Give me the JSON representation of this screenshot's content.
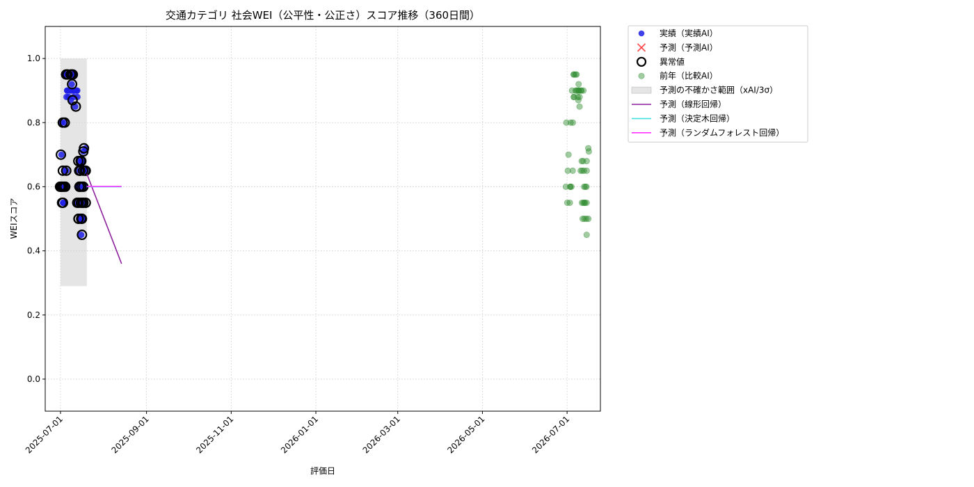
{
  "chart_data": {
    "type": "scatter",
    "title": "交通カテゴリ 社会WEI（公平性・公正さ）スコア推移（360日間）",
    "xlabel": "評価日",
    "ylabel": "WEIスコア",
    "xlim": [
      "2025-06-20",
      "2026-07-25"
    ],
    "ylim": [
      -0.1,
      1.1
    ],
    "x_ticks": [
      "2025-07-01",
      "2025-09-01",
      "2025-11-01",
      "2026-01-01",
      "2026-03-01",
      "2026-05-01",
      "2026-07-01"
    ],
    "y_ticks": [
      0.0,
      0.2,
      0.4,
      0.6,
      0.8,
      1.0
    ],
    "y_tick_labels": [
      "0.0",
      "0.2",
      "0.4",
      "0.6",
      "0.8",
      "1.0"
    ],
    "grid": true,
    "legend_position": "outside-right",
    "colors": {
      "actual": "#1f1fe6",
      "forecast": "#ff3333",
      "anomaly": "#000000",
      "prior_year": "#2e8b2e",
      "uncertainty": "#d3d3d3",
      "linear": "#8b1e9a",
      "tree": "#40e0e0",
      "forest": "#ff33ff"
    },
    "legend": [
      {
        "key": "actual",
        "label": "実績（実績AI）",
        "marker": "dot"
      },
      {
        "key": "forecast",
        "label": "予測（予測AI）",
        "marker": "cross"
      },
      {
        "key": "anomaly",
        "label": "異常値",
        "marker": "ring"
      },
      {
        "key": "prior_year",
        "label": "前年（比較AI）",
        "marker": "dot-faded"
      },
      {
        "key": "uncertainty",
        "label": "予測の不確かさ範囲（xAI/3σ）",
        "marker": "band"
      },
      {
        "key": "linear",
        "label": "予測（線形回帰）",
        "marker": "line"
      },
      {
        "key": "tree",
        "label": "予測（決定木回帰）",
        "marker": "line"
      },
      {
        "key": "forest",
        "label": "予測（ランダムフォレスト回帰）",
        "marker": "line"
      }
    ],
    "series": [
      {
        "key": "actual",
        "points": [
          {
            "x": "2025-07-01",
            "y": 0.7
          },
          {
            "x": "2025-07-01",
            "y": 0.6
          },
          {
            "x": "2025-07-02",
            "y": 0.8
          },
          {
            "x": "2025-07-02",
            "y": 0.6
          },
          {
            "x": "2025-07-02",
            "y": 0.55
          },
          {
            "x": "2025-07-03",
            "y": 0.65
          },
          {
            "x": "2025-07-03",
            "y": 0.6
          },
          {
            "x": "2025-07-03",
            "y": 0.55
          },
          {
            "x": "2025-07-04",
            "y": 0.8
          },
          {
            "x": "2025-07-04",
            "y": 0.6
          },
          {
            "x": "2025-07-05",
            "y": 0.65
          },
          {
            "x": "2025-07-05",
            "y": 0.6
          },
          {
            "x": "2025-07-05",
            "y": 0.95
          },
          {
            "x": "2025-07-05",
            "y": 0.9
          },
          {
            "x": "2025-07-06",
            "y": 0.95
          },
          {
            "x": "2025-07-06",
            "y": 0.9
          },
          {
            "x": "2025-07-06",
            "y": 0.88
          },
          {
            "x": "2025-07-07",
            "y": 0.95
          },
          {
            "x": "2025-07-07",
            "y": 0.9
          },
          {
            "x": "2025-07-08",
            "y": 0.95
          },
          {
            "x": "2025-07-08",
            "y": 0.9
          },
          {
            "x": "2025-07-08",
            "y": 0.88
          },
          {
            "x": "2025-07-09",
            "y": 0.95
          },
          {
            "x": "2025-07-09",
            "y": 0.9
          },
          {
            "x": "2025-07-09",
            "y": 0.87
          },
          {
            "x": "2025-07-10",
            "y": 0.95
          },
          {
            "x": "2025-07-10",
            "y": 0.92
          },
          {
            "x": "2025-07-10",
            "y": 0.9
          },
          {
            "x": "2025-07-11",
            "y": 0.9
          },
          {
            "x": "2025-07-11",
            "y": 0.88
          },
          {
            "x": "2025-07-12",
            "y": 0.9
          },
          {
            "x": "2025-07-12",
            "y": 0.85
          },
          {
            "x": "2025-07-13",
            "y": 0.9
          },
          {
            "x": "2025-07-13",
            "y": 0.88
          },
          {
            "x": "2025-07-14",
            "y": 0.9
          },
          {
            "x": "2025-07-14",
            "y": 0.68
          },
          {
            "x": "2025-07-14",
            "y": 0.65
          },
          {
            "x": "2025-07-14",
            "y": 0.6
          },
          {
            "x": "2025-07-14",
            "y": 0.55
          },
          {
            "x": "2025-07-14",
            "y": 0.5
          },
          {
            "x": "2025-07-15",
            "y": 0.68
          },
          {
            "x": "2025-07-15",
            "y": 0.65
          },
          {
            "x": "2025-07-15",
            "y": 0.6
          },
          {
            "x": "2025-07-15",
            "y": 0.55
          },
          {
            "x": "2025-07-15",
            "y": 0.5
          },
          {
            "x": "2025-07-16",
            "y": 0.68
          },
          {
            "x": "2025-07-16",
            "y": 0.65
          },
          {
            "x": "2025-07-16",
            "y": 0.55
          },
          {
            "x": "2025-07-16",
            "y": 0.5
          },
          {
            "x": "2025-07-17",
            "y": 0.65
          },
          {
            "x": "2025-07-17",
            "y": 0.6
          },
          {
            "x": "2025-07-17",
            "y": 0.55
          },
          {
            "x": "2025-07-17",
            "y": 0.5
          },
          {
            "x": "2025-07-17",
            "y": 0.45
          },
          {
            "x": "2025-07-18",
            "y": 0.72
          },
          {
            "x": "2025-07-18",
            "y": 0.71
          },
          {
            "x": "2025-07-18",
            "y": 0.65
          },
          {
            "x": "2025-07-18",
            "y": 0.6
          },
          {
            "x": "2025-07-18",
            "y": 0.55
          },
          {
            "x": "2025-07-19",
            "y": 0.65
          },
          {
            "x": "2025-07-19",
            "y": 0.55
          }
        ]
      },
      {
        "key": "anomaly",
        "points": [
          {
            "x": "2025-07-01",
            "y": 0.7
          },
          {
            "x": "2025-07-01",
            "y": 0.6
          },
          {
            "x": "2025-07-02",
            "y": 0.8
          },
          {
            "x": "2025-07-02",
            "y": 0.6
          },
          {
            "x": "2025-07-02",
            "y": 0.55
          },
          {
            "x": "2025-07-03",
            "y": 0.65
          },
          {
            "x": "2025-07-03",
            "y": 0.6
          },
          {
            "x": "2025-07-03",
            "y": 0.55
          },
          {
            "x": "2025-07-04",
            "y": 0.8
          },
          {
            "x": "2025-07-04",
            "y": 0.6
          },
          {
            "x": "2025-07-05",
            "y": 0.65
          },
          {
            "x": "2025-07-05",
            "y": 0.6
          },
          {
            "x": "2025-07-05",
            "y": 0.95
          },
          {
            "x": "2025-07-06",
            "y": 0.95
          },
          {
            "x": "2025-07-07",
            "y": 0.95
          },
          {
            "x": "2025-07-08",
            "y": 0.95
          },
          {
            "x": "2025-07-09",
            "y": 0.95
          },
          {
            "x": "2025-07-09",
            "y": 0.87
          },
          {
            "x": "2025-07-10",
            "y": 0.95
          },
          {
            "x": "2025-07-10",
            "y": 0.92
          },
          {
            "x": "2025-07-12",
            "y": 0.85
          },
          {
            "x": "2025-07-14",
            "y": 0.68
          },
          {
            "x": "2025-07-14",
            "y": 0.65
          },
          {
            "x": "2025-07-14",
            "y": 0.6
          },
          {
            "x": "2025-07-14",
            "y": 0.55
          },
          {
            "x": "2025-07-14",
            "y": 0.5
          },
          {
            "x": "2025-07-15",
            "y": 0.68
          },
          {
            "x": "2025-07-15",
            "y": 0.65
          },
          {
            "x": "2025-07-15",
            "y": 0.6
          },
          {
            "x": "2025-07-15",
            "y": 0.55
          },
          {
            "x": "2025-07-15",
            "y": 0.5
          },
          {
            "x": "2025-07-16",
            "y": 0.68
          },
          {
            "x": "2025-07-16",
            "y": 0.65
          },
          {
            "x": "2025-07-16",
            "y": 0.55
          },
          {
            "x": "2025-07-16",
            "y": 0.5
          },
          {
            "x": "2025-07-17",
            "y": 0.65
          },
          {
            "x": "2025-07-17",
            "y": 0.6
          },
          {
            "x": "2025-07-17",
            "y": 0.55
          },
          {
            "x": "2025-07-17",
            "y": 0.5
          },
          {
            "x": "2025-07-17",
            "y": 0.45
          },
          {
            "x": "2025-07-18",
            "y": 0.72
          },
          {
            "x": "2025-07-18",
            "y": 0.71
          },
          {
            "x": "2025-07-18",
            "y": 0.65
          },
          {
            "x": "2025-07-18",
            "y": 0.6
          },
          {
            "x": "2025-07-18",
            "y": 0.55
          },
          {
            "x": "2025-07-19",
            "y": 0.65
          },
          {
            "x": "2025-07-19",
            "y": 0.55
          }
        ]
      },
      {
        "key": "prior_year",
        "points": [
          {
            "x": "2026-07-01",
            "y": 0.8
          },
          {
            "x": "2026-07-01",
            "y": 0.7
          },
          {
            "x": "2026-07-01",
            "y": 0.6
          },
          {
            "x": "2026-07-02",
            "y": 0.65
          },
          {
            "x": "2026-07-02",
            "y": 0.6
          },
          {
            "x": "2026-07-02",
            "y": 0.55
          },
          {
            "x": "2026-07-03",
            "y": 0.8
          },
          {
            "x": "2026-07-03",
            "y": 0.6
          },
          {
            "x": "2026-07-03",
            "y": 0.55
          },
          {
            "x": "2026-07-04",
            "y": 0.8
          },
          {
            "x": "2026-07-04",
            "y": 0.65
          },
          {
            "x": "2026-07-04",
            "y": 0.6
          },
          {
            "x": "2026-07-05",
            "y": 0.95
          },
          {
            "x": "2026-07-05",
            "y": 0.9
          },
          {
            "x": "2026-07-05",
            "y": 0.88
          },
          {
            "x": "2026-07-06",
            "y": 0.95
          },
          {
            "x": "2026-07-06",
            "y": 0.9
          },
          {
            "x": "2026-07-06",
            "y": 0.88
          },
          {
            "x": "2026-07-07",
            "y": 0.95
          },
          {
            "x": "2026-07-07",
            "y": 0.9
          },
          {
            "x": "2026-07-08",
            "y": 0.95
          },
          {
            "x": "2026-07-08",
            "y": 0.9
          },
          {
            "x": "2026-07-08",
            "y": 0.87
          },
          {
            "x": "2026-07-09",
            "y": 0.92
          },
          {
            "x": "2026-07-09",
            "y": 0.9
          },
          {
            "x": "2026-07-09",
            "y": 0.88
          },
          {
            "x": "2026-07-10",
            "y": 0.9
          },
          {
            "x": "2026-07-10",
            "y": 0.85
          },
          {
            "x": "2026-07-11",
            "y": 0.9
          },
          {
            "x": "2026-07-11",
            "y": 0.88
          },
          {
            "x": "2026-07-12",
            "y": 0.9
          },
          {
            "x": "2026-07-12",
            "y": 0.68
          },
          {
            "x": "2026-07-12",
            "y": 0.65
          },
          {
            "x": "2026-07-12",
            "y": 0.6
          },
          {
            "x": "2026-07-12",
            "y": 0.55
          },
          {
            "x": "2026-07-12",
            "y": 0.5
          },
          {
            "x": "2026-07-13",
            "y": 0.9
          },
          {
            "x": "2026-07-13",
            "y": 0.68
          },
          {
            "x": "2026-07-13",
            "y": 0.65
          },
          {
            "x": "2026-07-13",
            "y": 0.6
          },
          {
            "x": "2026-07-13",
            "y": 0.55
          },
          {
            "x": "2026-07-13",
            "y": 0.5
          },
          {
            "x": "2026-07-14",
            "y": 0.65
          },
          {
            "x": "2026-07-14",
            "y": 0.55
          },
          {
            "x": "2026-07-14",
            "y": 0.5
          },
          {
            "x": "2026-07-15",
            "y": 0.68
          },
          {
            "x": "2026-07-15",
            "y": 0.6
          },
          {
            "x": "2026-07-15",
            "y": 0.55
          },
          {
            "x": "2026-07-15",
            "y": 0.5
          },
          {
            "x": "2026-07-15",
            "y": 0.45
          },
          {
            "x": "2026-07-16",
            "y": 0.72
          },
          {
            "x": "2026-07-16",
            "y": 0.71
          },
          {
            "x": "2026-07-16",
            "y": 0.65
          },
          {
            "x": "2026-07-16",
            "y": 0.55
          }
        ]
      }
    ],
    "uncertainty_band": {
      "x_start": "2025-07-01",
      "x_end": "2025-07-20",
      "y_low": 0.29,
      "y_high": 1.0
    },
    "forecast_lines": [
      {
        "key": "linear",
        "points": [
          {
            "x": "2025-07-20",
            "y": 0.64
          },
          {
            "x": "2025-08-14",
            "y": 0.36
          }
        ]
      },
      {
        "key": "tree",
        "points": [
          {
            "x": "2025-07-20",
            "y": 0.6
          },
          {
            "x": "2025-08-14",
            "y": 0.6
          }
        ]
      },
      {
        "key": "forest",
        "points": [
          {
            "x": "2025-07-20",
            "y": 0.601
          },
          {
            "x": "2025-08-14",
            "y": 0.601
          }
        ]
      }
    ]
  }
}
